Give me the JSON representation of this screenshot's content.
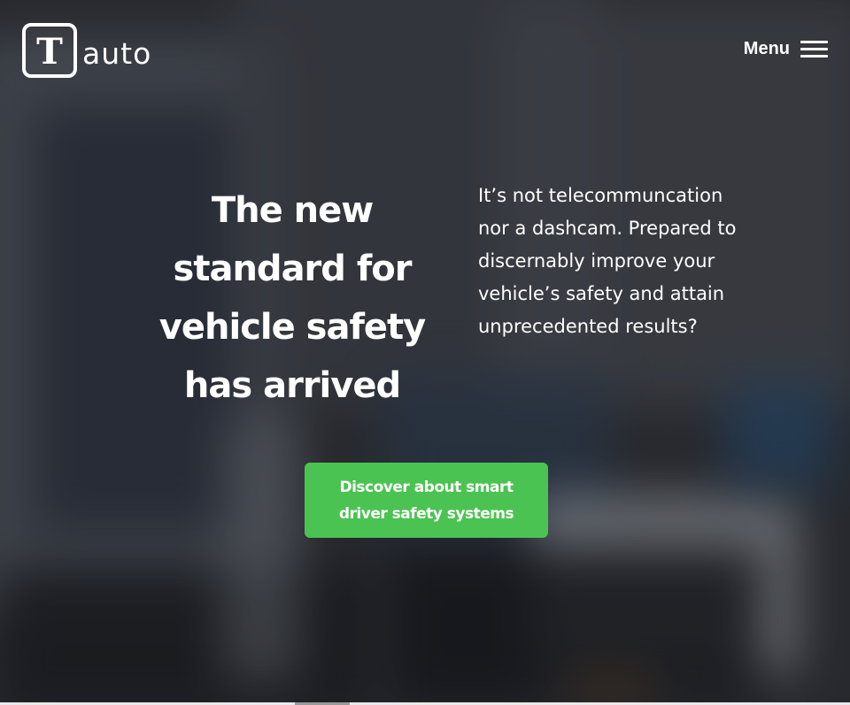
{
  "brand": {
    "logo_letter": "T",
    "name": "auto"
  },
  "nav": {
    "menu_label": "Menu",
    "menu_icon": "hamburger-icon"
  },
  "hero": {
    "headline": "The new standard for vehicle safety has arrived",
    "description": "It’s not telecommuncation nor a dashcam. Prepared to discernably improve your vehicle’s safety and attain unprecedented results?",
    "cta_label": "Discover about smart driver safety systems"
  },
  "colors": {
    "accent": "#4bc352",
    "text": "#ffffff",
    "overlay": "#2a2c30"
  }
}
